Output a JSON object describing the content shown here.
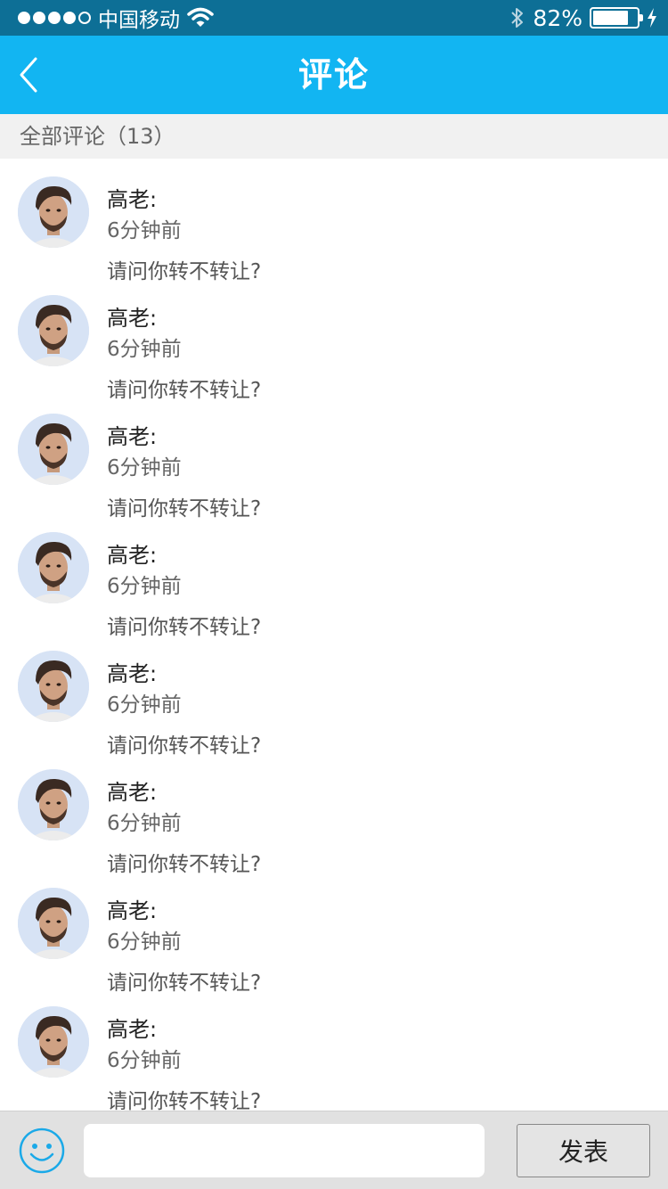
{
  "status_bar": {
    "carrier": "中国移动",
    "battery_pct": "82%",
    "battery_level": 0.82,
    "signal_bars": 4,
    "icons": [
      "signal-dots-icon",
      "wifi-icon",
      "bluetooth-icon",
      "battery-icon",
      "charging-icon"
    ]
  },
  "nav": {
    "title": "评论",
    "back_icon": "chevron-left-icon"
  },
  "section": {
    "header": "全部评论（13）"
  },
  "comments": [
    {
      "name": "高老:",
      "time": "6分钟前",
      "text": "请问你转不转让?"
    },
    {
      "name": "高老:",
      "time": "6分钟前",
      "text": "请问你转不转让?"
    },
    {
      "name": "高老:",
      "time": "6分钟前",
      "text": "请问你转不转让?"
    },
    {
      "name": "高老:",
      "time": "6分钟前",
      "text": "请问你转不转让?"
    },
    {
      "name": "高老:",
      "time": "6分钟前",
      "text": "请问你转不转让?"
    },
    {
      "name": "高老:",
      "time": "6分钟前",
      "text": "请问你转不转让?"
    },
    {
      "name": "高老:",
      "time": "6分钟前",
      "text": "请问你转不转让?"
    },
    {
      "name": "高老:",
      "time": "6分钟前",
      "text": "请问你转不转让?"
    }
  ],
  "input_bar": {
    "emoji_icon": "smiley-icon",
    "input_value": "",
    "input_placeholder": "",
    "submit_label": "发表"
  },
  "colors": {
    "status_bar": "#0d6f96",
    "nav_bar": "#12b5f2",
    "emoji_icon": "#1aa9e8"
  }
}
